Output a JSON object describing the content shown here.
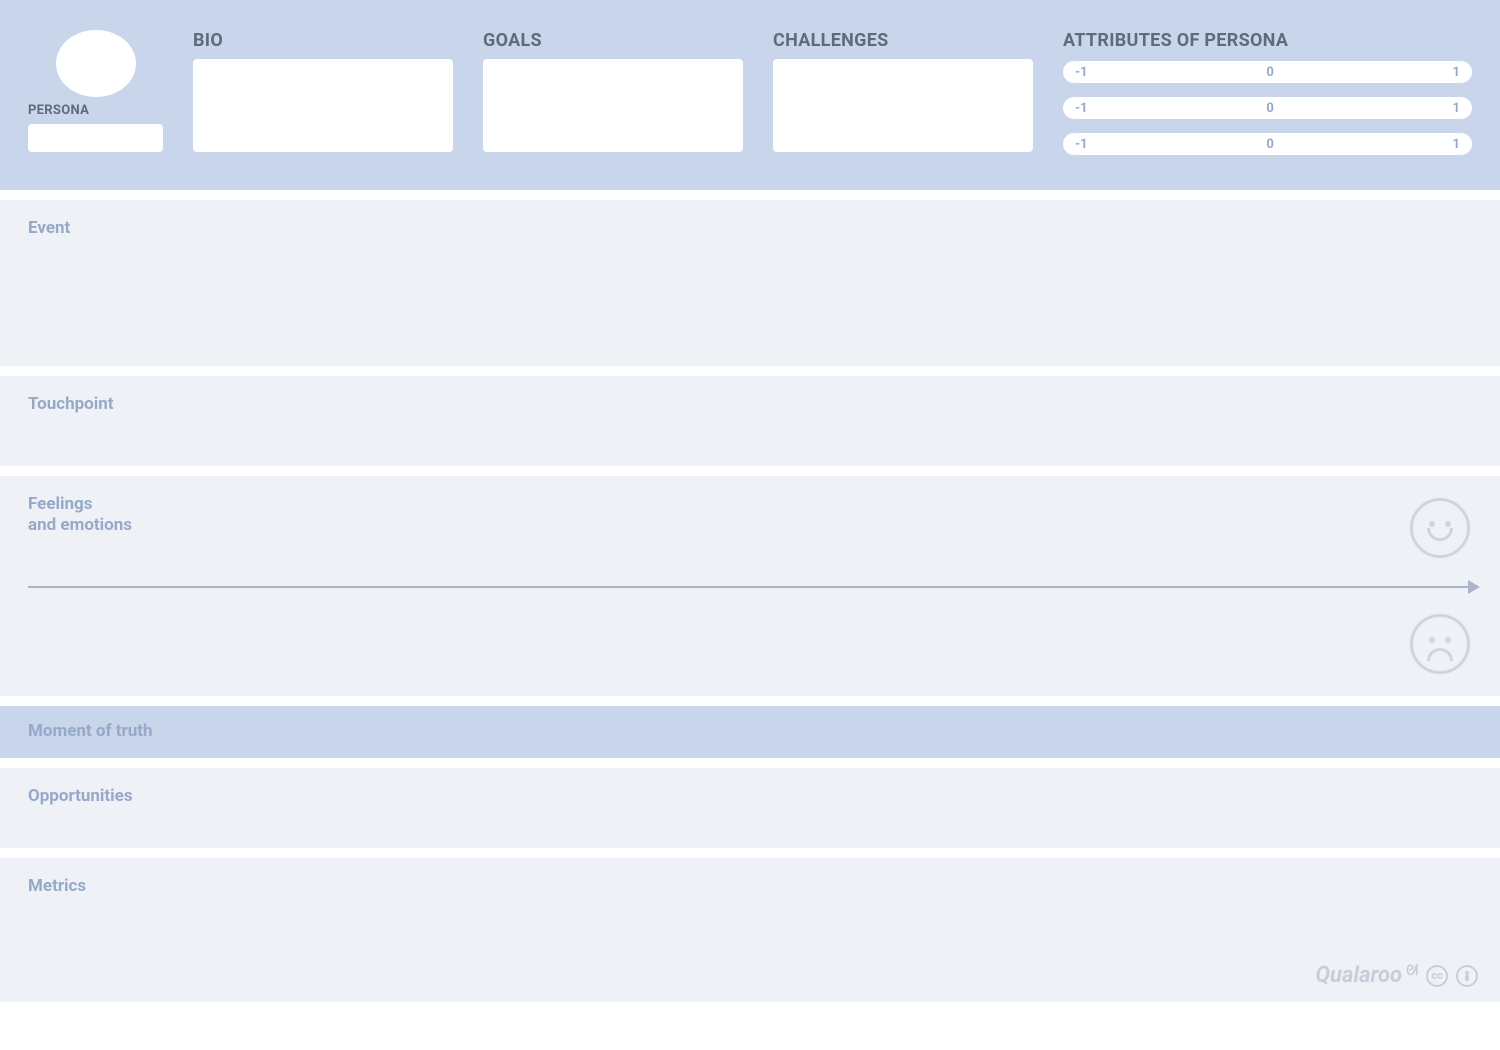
{
  "header": {
    "persona_label": "PERSONA",
    "bio_label": "BIO",
    "goals_label": "GOALS",
    "challenges_label": "CHALLENGES",
    "attributes_label": "ATTRIBUTES OF PERSONA",
    "attributes": [
      {
        "min": "-1",
        "mid": "0",
        "max": "1"
      },
      {
        "min": "-1",
        "mid": "0",
        "max": "1"
      },
      {
        "min": "-1",
        "mid": "0",
        "max": "1"
      }
    ]
  },
  "rows": {
    "event": "Event",
    "touchpoint": "Touchpoint",
    "feelings_line1": "Feelings",
    "feelings_line2": "and emotions",
    "moment": "Moment of truth",
    "opportunities": "Opportunities",
    "metrics": "Metrics"
  },
  "footer": {
    "brand": "Qualaroo",
    "cc": "cc",
    "by": "🄯"
  }
}
